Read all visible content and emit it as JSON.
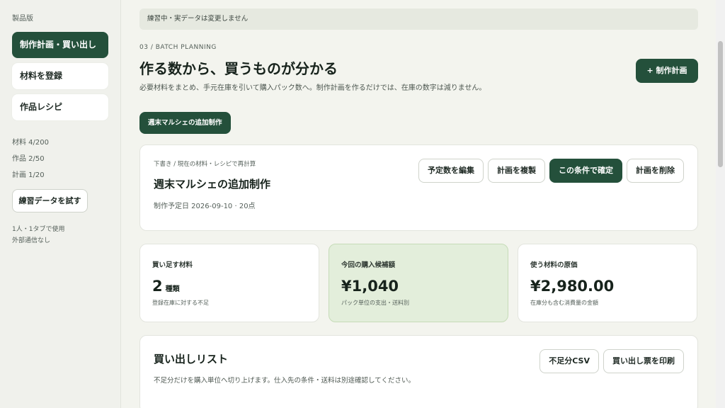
{
  "sidebar": {
    "edition": "製品版",
    "nav": [
      {
        "label": "制作計画・買い出し",
        "active": true
      },
      {
        "label": "材料を登録",
        "active": false
      },
      {
        "label": "作品レシピ",
        "active": false
      }
    ],
    "stats": [
      "材料 4/200",
      "作品 2/50",
      "計画 1/20"
    ],
    "sample_button": "練習データを試す",
    "note_lines": [
      "1人・1タブで使用",
      "外部通信なし"
    ]
  },
  "banner": "練習中・実データは変更しません",
  "header": {
    "eyebrow": "03 / BATCH PLANNING",
    "title": "作る数から、買うものが分かる",
    "subtitle": "必要材料をまとめ、手元在庫を引いて購入パック数へ。制作計画を作るだけでは、在庫の数字は減りません。",
    "new_plan_button": "+ 制作計画"
  },
  "plan_chip": "週末マルシェの追加制作",
  "plan": {
    "meta": "下書き / 現在の材料・レシピで再計算",
    "name": "週末マルシェの追加制作",
    "date_line": "制作予定日 2026-09-10 · 20点",
    "actions": [
      "予定数を編集",
      "計画を複製",
      "この条件で確定",
      "計画を削除"
    ]
  },
  "metrics": [
    {
      "label": "買い足す材料",
      "value": "2",
      "unit": "種類",
      "note": "登録在庫に対する不足"
    },
    {
      "label": "今回の購入候補額",
      "value": "¥1,040",
      "unit": "",
      "note": "パック単位の支出・送料別"
    },
    {
      "label": "使う材料の原価",
      "value": "¥2,980.00",
      "unit": "",
      "note": "在庫分も含む消費量の金額"
    }
  ],
  "shopping": {
    "title": "買い出しリスト",
    "description": "不足分だけを購入単位へ切り上げます。仕入先の条件・送料は別途確認してください。",
    "csv_button": "不足分CSV",
    "print_button": "買い出し票を印刷"
  },
  "colors": {
    "accent": "#24503b",
    "highlight": "#e3eedb",
    "background": "#f3f4ee"
  }
}
